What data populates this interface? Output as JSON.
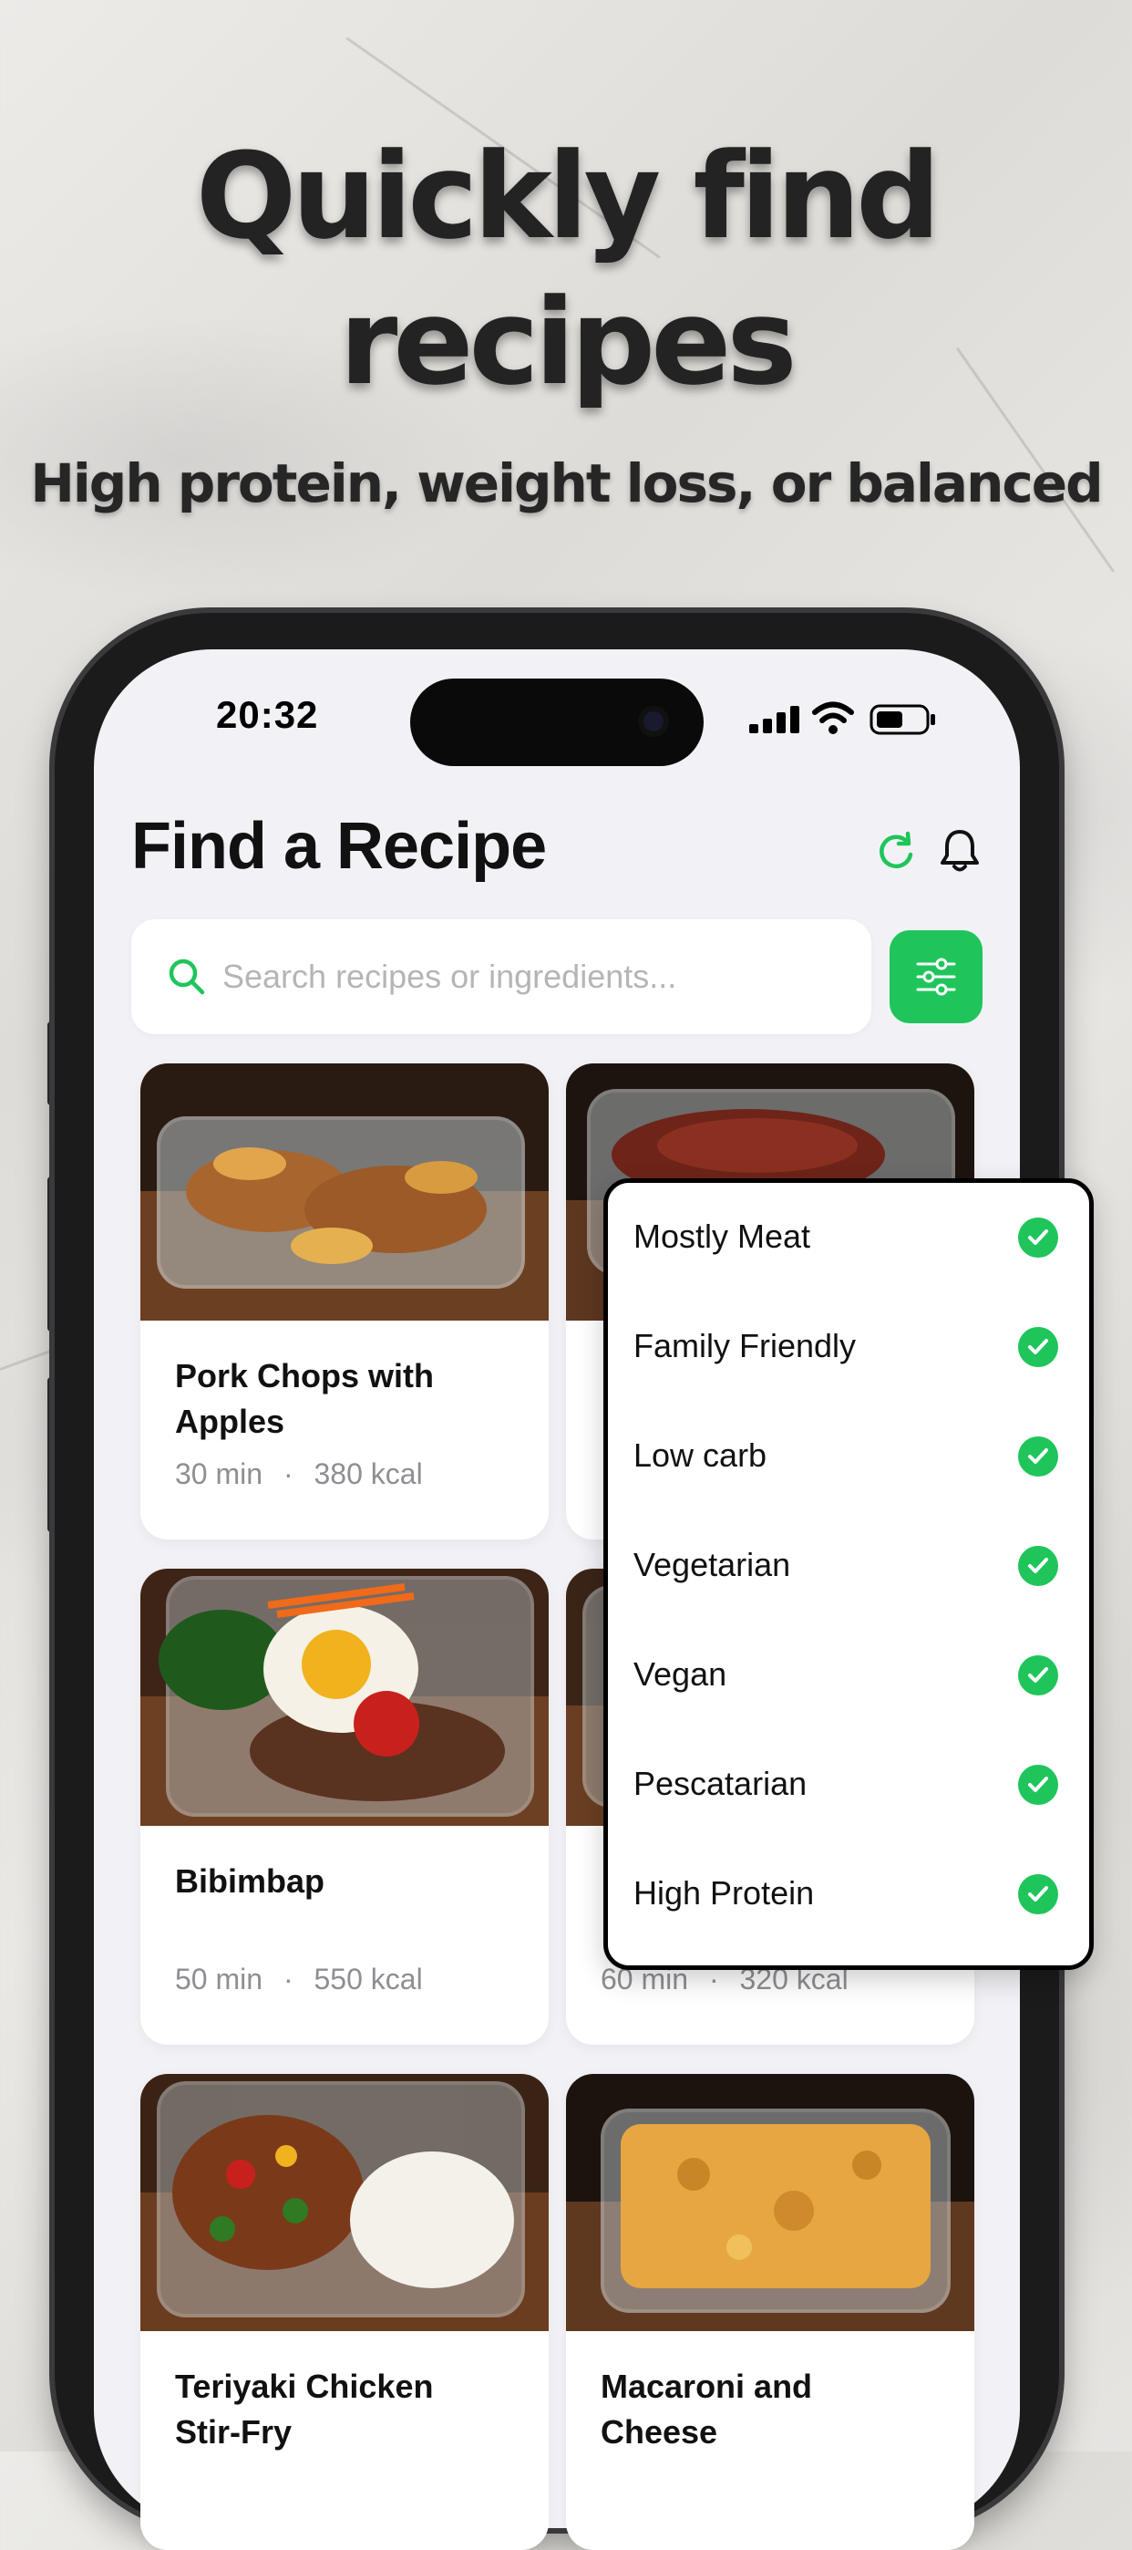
{
  "promo": {
    "headline_line1": "Quickly find",
    "headline_line2": "recipes",
    "subheadline": "High protein, weight loss, or balanced"
  },
  "status_bar": {
    "time": "20:32"
  },
  "header": {
    "title": "Find a Recipe",
    "refresh_icon": "refresh-icon",
    "notification_icon": "bell-icon"
  },
  "search": {
    "placeholder": "Search recipes or ingredients...",
    "icon": "search-icon",
    "filter_icon": "sliders-icon"
  },
  "colors": {
    "accent": "#1fc55a",
    "background": "#f2f2f6",
    "meta_text": "#8e8e93"
  },
  "recipes": [
    {
      "title": "Pork Chops with Apples",
      "time": "30 min",
      "kcal": "380 kcal"
    },
    {
      "title": "",
      "time": "",
      "kcal": ""
    },
    {
      "title": "Bibimbap",
      "time": "50 min",
      "kcal": "550 kcal"
    },
    {
      "title": "",
      "time": "60 min",
      "kcal": "320 kcal"
    },
    {
      "title": "Teriyaki Chicken Stir-Fry",
      "time": "",
      "kcal": ""
    },
    {
      "title": "Macaroni and Cheese",
      "time": "",
      "kcal": ""
    }
  ],
  "meta_separator": "·",
  "filter_menu": {
    "options": [
      {
        "label": "Mostly Meat",
        "checked": true
      },
      {
        "label": "Family Friendly",
        "checked": true
      },
      {
        "label": "Low carb",
        "checked": true
      },
      {
        "label": "Vegetarian",
        "checked": true
      },
      {
        "label": "Vegan",
        "checked": true
      },
      {
        "label": "Pescatarian",
        "checked": true
      },
      {
        "label": "High Protein",
        "checked": true
      }
    ]
  }
}
